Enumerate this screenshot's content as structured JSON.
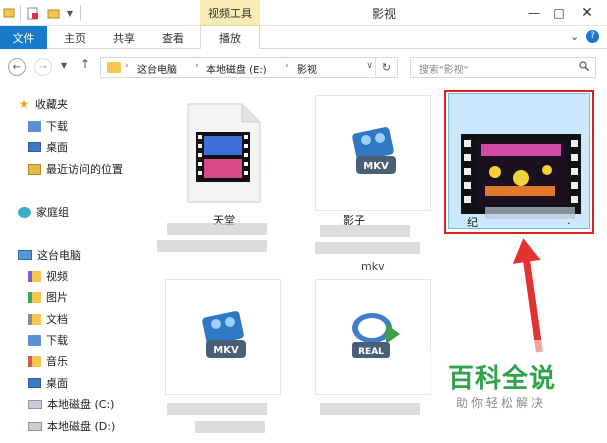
{
  "titlebar": {
    "context_tab": "视频工具",
    "window_title": "影视"
  },
  "ribbon": {
    "tabs": [
      "文件",
      "主页",
      "共享",
      "查看",
      "播放"
    ]
  },
  "address": {
    "crumbs": [
      "这台电脑",
      "本地磁盘 (E:)",
      "影视"
    ],
    "search_placeholder": "搜索\"影视\""
  },
  "nav": {
    "favorites": "收藏夹",
    "fav_items": [
      "下载",
      "桌面",
      "最近访问的位置"
    ],
    "homegroup": "家庭组",
    "this_pc": "这台电脑",
    "pc_items": [
      "视频",
      "图片",
      "文档",
      "下载",
      "音乐",
      "桌面",
      "本地磁盘 (C:)",
      "本地磁盘 (D:)"
    ]
  },
  "files": [
    {
      "type": "video-generic",
      "name_fragment": "天堂"
    },
    {
      "type": "mkv",
      "badge": "MKV",
      "name_fragment": "影子"
    },
    {
      "type": "thumbnail",
      "name_fragment": "纪",
      "ext_fragment": "."
    },
    {
      "type": "mkv",
      "badge": "MKV",
      "name_fragment": ""
    },
    {
      "type": "real",
      "badge": "REAL",
      "name_fragment": ""
    }
  ],
  "extra_text": "mkv",
  "watermark": {
    "main": "百科全说",
    "sub": "助你轻松解决"
  },
  "colors": {
    "file_tab": "#1979ca",
    "context_tab": "#f6ecb3",
    "selection": "#cce8ff",
    "highlight_box": "#e02020",
    "watermark_green": "#2fa24a"
  }
}
